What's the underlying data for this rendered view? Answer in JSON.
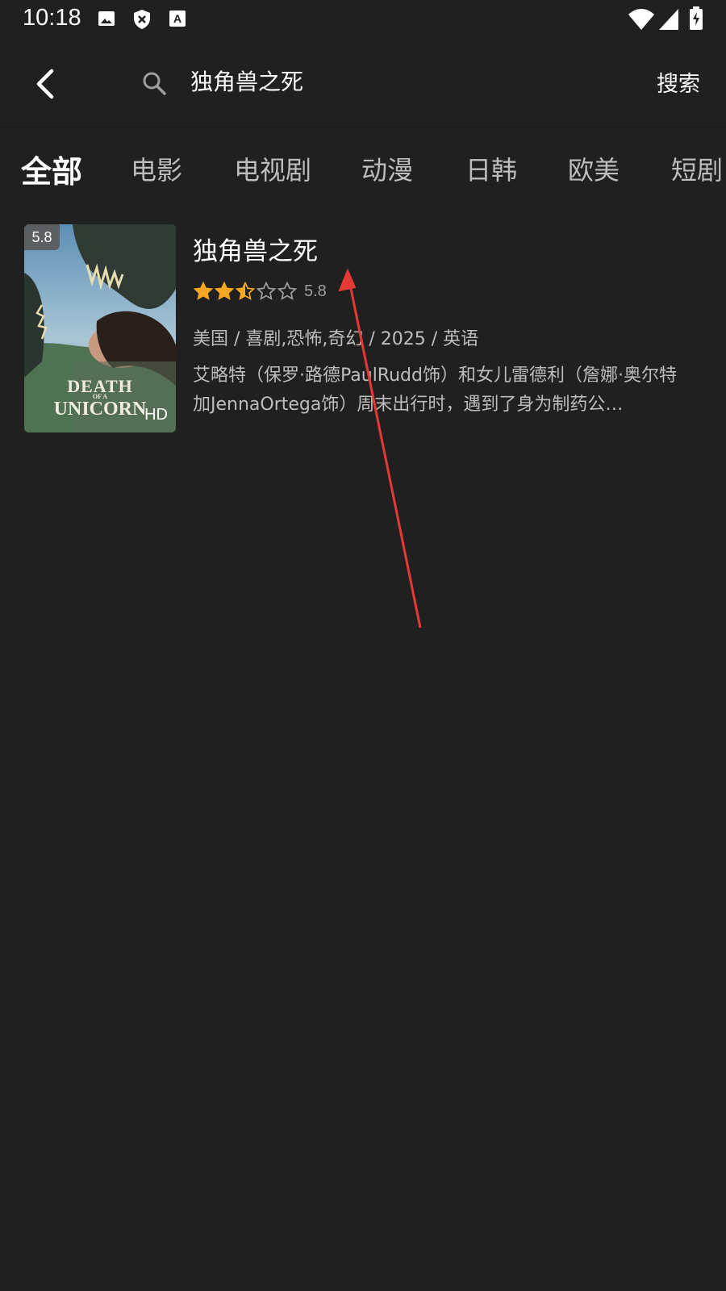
{
  "status_bar": {
    "time": "10:18",
    "left_icons": [
      "image-icon",
      "shield-x-icon",
      "keyboard-a-icon"
    ],
    "right_icons": [
      "wifi-icon",
      "cellular-signal-icon",
      "battery-charging-icon"
    ]
  },
  "search": {
    "query": "独角兽之死",
    "submit_label": "搜索"
  },
  "tabs": [
    {
      "label": "全部",
      "active": true
    },
    {
      "label": "电影",
      "active": false
    },
    {
      "label": "电视剧",
      "active": false
    },
    {
      "label": "动漫",
      "active": false
    },
    {
      "label": "日韩",
      "active": false
    },
    {
      "label": "欧美",
      "active": false
    },
    {
      "label": "短剧",
      "active": false
    }
  ],
  "results": [
    {
      "poster": {
        "score": "5.8",
        "quality": "HD",
        "title_line1": "DEATH",
        "title_line2": "OF A",
        "title_line3": "UNICORN"
      },
      "title": "独角兽之死",
      "rating_stars": 2.5,
      "rating_max": 5,
      "rating_value": "5.8",
      "meta": "美国 / 喜剧,恐怖,奇幻 / 2025 / 英语",
      "description": "艾略特（保罗·路德PaulRudd饰）和女儿雷德利（詹娜·奥尔特加JennaOrtega饰）周末出行时，遇到了身为制药公…"
    }
  ],
  "colors": {
    "background": "#202020",
    "star_filled": "#f5a623",
    "star_empty": "#9e9e9e",
    "annotation_arrow": "#e53935"
  }
}
